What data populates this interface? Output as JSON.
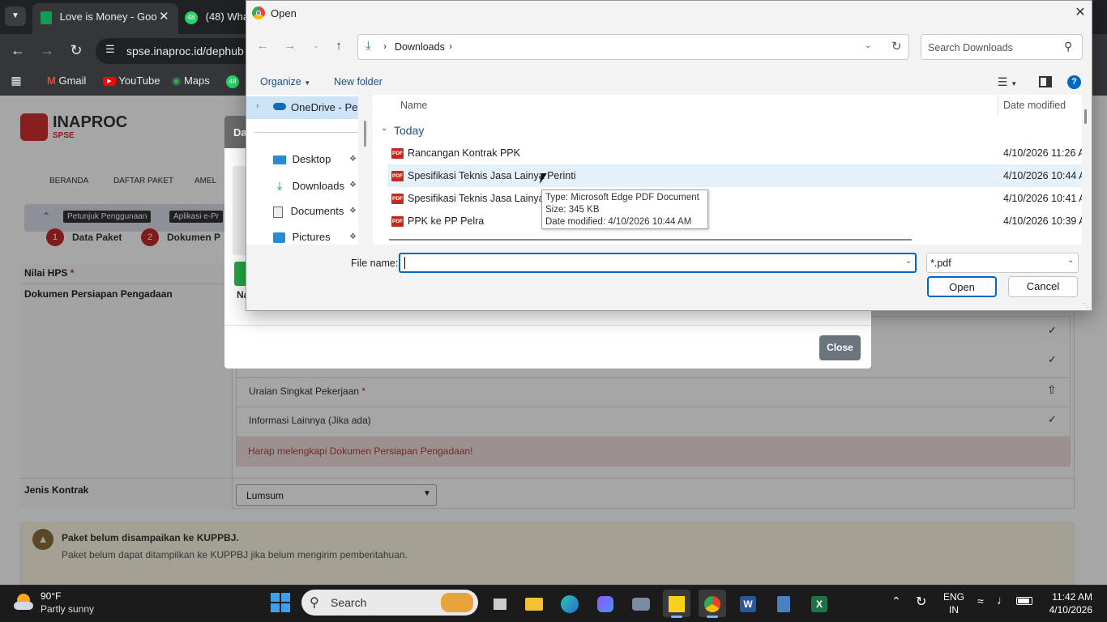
{
  "browser": {
    "tabs": [
      {
        "title": "Love is Money - Goo",
        "icon": "sheets-icon",
        "color": "#0f9d58"
      },
      {
        "title": "(48) Wha",
        "icon": "whatsapp-icon",
        "badge": "48",
        "color": "#25d366"
      }
    ],
    "url": "spse.inaproc.id/dephub",
    "bookmarks": [
      "Gmail",
      "YouTube",
      "Maps",
      "48"
    ]
  },
  "page": {
    "logo": {
      "name": "INAPROC",
      "sub": "SPSE"
    },
    "nav": [
      "BERANDA",
      "DAFTAR PAKET",
      "AMEL"
    ],
    "tools": [
      "Petunjuk Penggunaan",
      "Aplikasi e-Pr"
    ],
    "steps": [
      "Data Paket",
      "Dokumen P"
    ],
    "step_nums": [
      "1",
      "2"
    ],
    "nilai_hps_label": "Nilai HPS",
    "dokumen_label": "Dokumen Persiapan Pengadaan",
    "doc_items": [
      "Uraian Singkat Pekerjaan",
      "Informasi Lainnya (Jika ada)"
    ],
    "required_mark": "*",
    "alert_text": "Harap melengkapi Dokumen Persiapan Pengadaan!",
    "jenis_kontrak_label": "Jenis Kontrak",
    "jenis_kontrak_value": "Lumsum",
    "warning_title": "Paket belum disampaikan ke KUPPBJ.",
    "warning_body": "Paket belum dapat ditampilkan ke KUPPBJ jika belum mengirim pemberitahuan.",
    "modal_title_partial": "Da",
    "modal_na": "Na",
    "modal_close": "Close"
  },
  "dialog": {
    "title": "Open",
    "breadcrumb": "Downloads",
    "search_placeholder": "Search Downloads",
    "organize": "Organize",
    "new_folder": "New folder",
    "nav_items": [
      {
        "label": "OneDrive - Perso",
        "icon": "onedrive-icon"
      },
      {
        "label": "Desktop",
        "icon": "desktop-icon"
      },
      {
        "label": "Downloads",
        "icon": "downloads-icon"
      },
      {
        "label": "Documents",
        "icon": "documents-icon"
      },
      {
        "label": "Pictures",
        "icon": "pictures-icon"
      }
    ],
    "col_name": "Name",
    "col_date": "Date modified",
    "group": "Today",
    "files": [
      {
        "name": "Rancangan Kontrak PPK",
        "date": "4/10/2026 11:26 A"
      },
      {
        "name": "Spesifikasi Teknis Jasa Lainya Perinti",
        "date": "4/10/2026 10:44 A"
      },
      {
        "name": "Spesifikasi Teknis Jasa Lainya Pe",
        "date": "4/10/2026 10:41 A"
      },
      {
        "name": "PPK ke PP Pelra",
        "date": "4/10/2026 10:39 A"
      }
    ],
    "tooltip": [
      "Type: Microsoft Edge PDF Document",
      "Size: 345 KB",
      "Date modified: 4/10/2026 10:44 AM"
    ],
    "file_name_label": "File name:",
    "file_name_value": "",
    "filter": "*.pdf",
    "open": "Open",
    "cancel": "Cancel"
  },
  "taskbar": {
    "weather_temp": "90°F",
    "weather_desc": "Partly sunny",
    "search": "Search",
    "lang": "ENG",
    "region": "IN",
    "time": "11:42 AM",
    "date": "4/10/2026"
  }
}
